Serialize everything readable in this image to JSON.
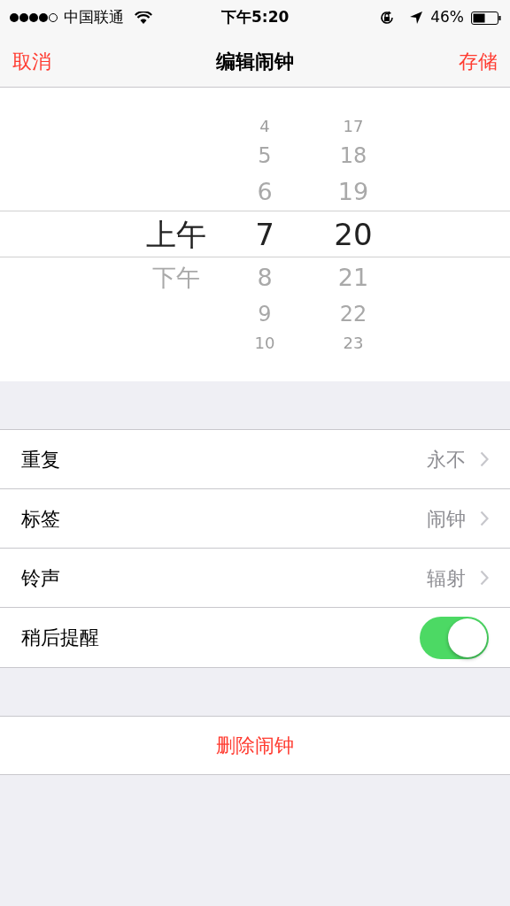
{
  "status_bar": {
    "carrier": "中国联通",
    "time": "下午5:20",
    "battery": "46%"
  },
  "nav": {
    "cancel": "取消",
    "title": "编辑闹钟",
    "save": "存储"
  },
  "picker": {
    "columns": [
      {
        "items": [
          {
            "label": "上午",
            "selected": true
          },
          {
            "label": "下午",
            "selected": false
          }
        ]
      },
      {
        "items": [
          {
            "label": "4",
            "selected": false
          },
          {
            "label": "5",
            "selected": false
          },
          {
            "label": "6",
            "selected": false
          },
          {
            "label": "7",
            "selected": true
          },
          {
            "label": "8",
            "selected": false
          },
          {
            "label": "9",
            "selected": false
          },
          {
            "label": "10",
            "selected": false
          }
        ]
      },
      {
        "items": [
          {
            "label": "17",
            "selected": false
          },
          {
            "label": "18",
            "selected": false
          },
          {
            "label": "19",
            "selected": false
          },
          {
            "label": "20",
            "selected": true
          },
          {
            "label": "21",
            "selected": false
          },
          {
            "label": "22",
            "selected": false
          },
          {
            "label": "23",
            "selected": false
          }
        ]
      }
    ]
  },
  "settings": [
    {
      "kind": "link",
      "label": "重复",
      "value": "永不"
    },
    {
      "kind": "link",
      "label": "标签",
      "value": "闹钟"
    },
    {
      "kind": "link",
      "label": "铃声",
      "value": "辐射"
    },
    {
      "kind": "toggle",
      "label": "稍后提醒",
      "on": true
    }
  ],
  "delete_button": "删除闹钟"
}
